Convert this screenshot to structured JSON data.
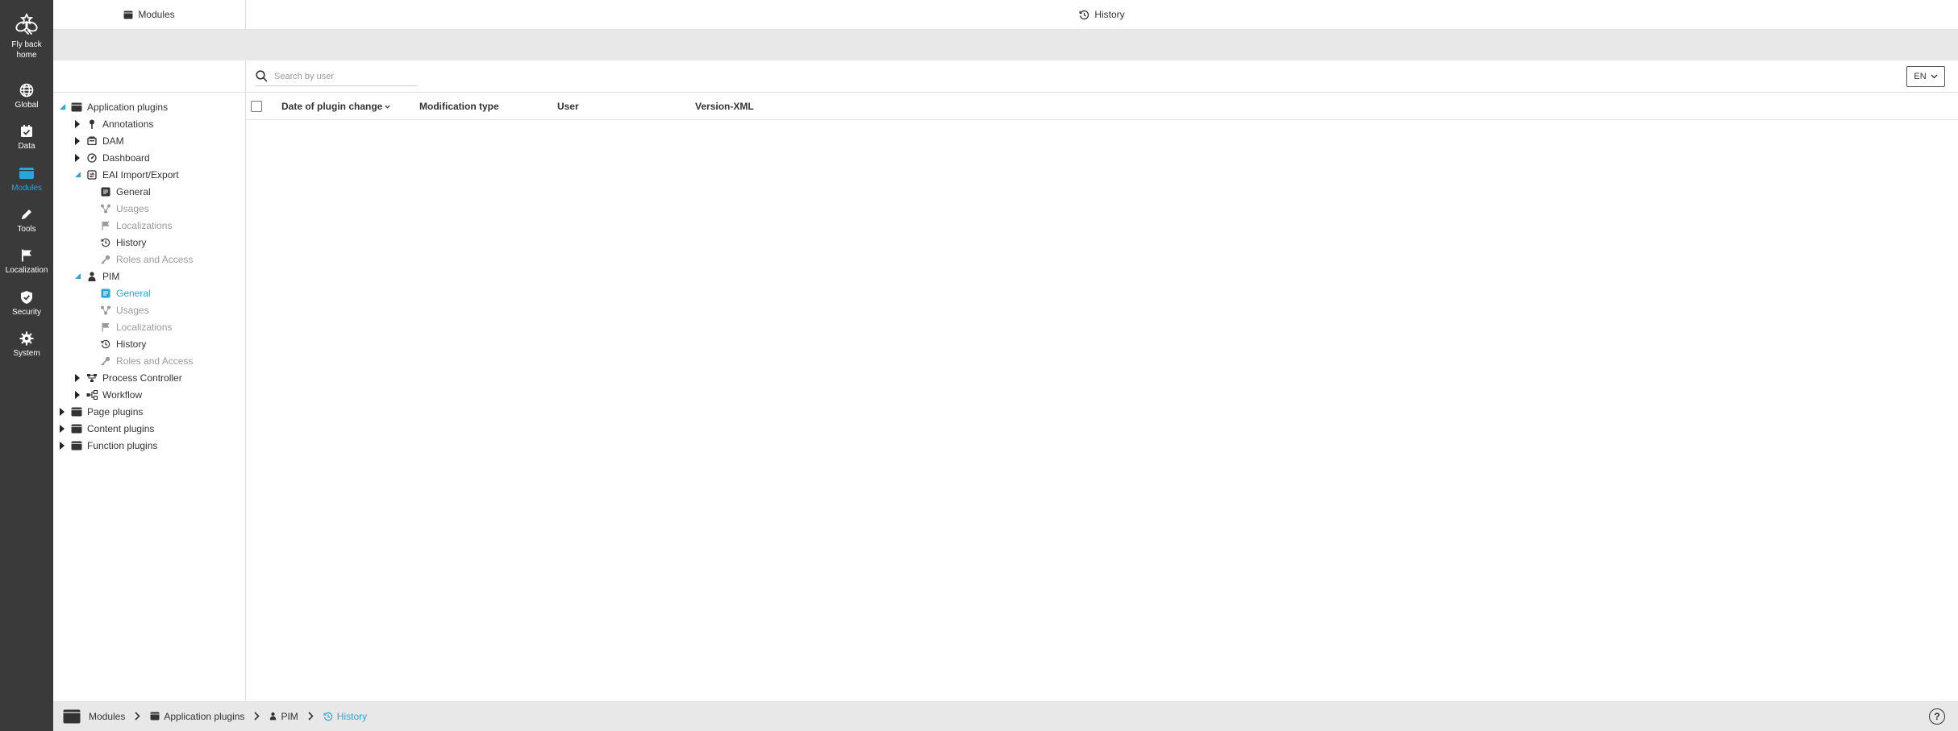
{
  "rail": {
    "items": [
      {
        "label": "Fly back home",
        "icon": "bee-logo-icon"
      },
      {
        "label": "Global",
        "icon": "globe-icon"
      },
      {
        "label": "Data",
        "icon": "calendar-check-icon"
      },
      {
        "label": "Modules",
        "icon": "module-icon"
      },
      {
        "label": "Tools",
        "icon": "pencil-icon"
      },
      {
        "label": "Localization",
        "icon": "flag-icon"
      },
      {
        "label": "Security",
        "icon": "shield-check-icon"
      },
      {
        "label": "System",
        "icon": "gear-icon"
      }
    ],
    "active": "Modules",
    "accent": "#2aa5db"
  },
  "header": {
    "left_title": "Modules",
    "main_title": "History"
  },
  "tree": {
    "items": [
      {
        "label": "Application plugins",
        "icon": "module-icon",
        "state": "expanded"
      },
      {
        "label": "Annotations",
        "icon": "pin-icon",
        "state": "collapsed"
      },
      {
        "label": "DAM",
        "icon": "dam-icon",
        "state": "collapsed"
      },
      {
        "label": "Dashboard",
        "icon": "dashboard-icon",
        "state": "collapsed"
      },
      {
        "label": "EAI Import/Export",
        "icon": "eai-icon",
        "state": "expanded"
      },
      {
        "label": "General",
        "icon": "general-icon",
        "state": "leaf"
      },
      {
        "label": "Usages",
        "icon": "usages-icon",
        "state": "leaf-muted"
      },
      {
        "label": "Localizations",
        "icon": "flag-icon",
        "state": "leaf-muted"
      },
      {
        "label": "History",
        "icon": "history-icon",
        "state": "leaf"
      },
      {
        "label": "Roles and Access",
        "icon": "key-icon",
        "state": "leaf-muted"
      },
      {
        "label": "PIM",
        "icon": "pim-icon",
        "state": "expanded"
      },
      {
        "label": "General",
        "icon": "general-icon",
        "state": "leaf-selected"
      },
      {
        "label": "Usages",
        "icon": "usages-icon",
        "state": "leaf-muted"
      },
      {
        "label": "Localizations",
        "icon": "flag-icon",
        "state": "leaf-muted"
      },
      {
        "label": "History",
        "icon": "history-icon",
        "state": "leaf"
      },
      {
        "label": "Roles and Access",
        "icon": "key-icon",
        "state": "leaf-muted"
      },
      {
        "label": "Process Controller",
        "icon": "process-icon",
        "state": "collapsed"
      },
      {
        "label": "Workflow",
        "icon": "workflow-icon",
        "state": "collapsed"
      },
      {
        "label": "Page plugins",
        "icon": "module-icon",
        "state": "collapsed"
      },
      {
        "label": "Content plugins",
        "icon": "module-icon",
        "state": "collapsed"
      },
      {
        "label": "Function plugins",
        "icon": "module-icon",
        "state": "collapsed"
      }
    ]
  },
  "search": {
    "placeholder": "Search by user",
    "value": ""
  },
  "language": {
    "selected": "EN"
  },
  "table": {
    "columns": [
      "Date of plugin change",
      "Modification type",
      "User",
      "Version-XML"
    ],
    "sorted_column": "Date of plugin change",
    "rows": []
  },
  "breadcrumb": {
    "items": [
      "Modules",
      "Application plugins",
      "PIM",
      "History"
    ]
  },
  "help": {
    "label": "?"
  }
}
